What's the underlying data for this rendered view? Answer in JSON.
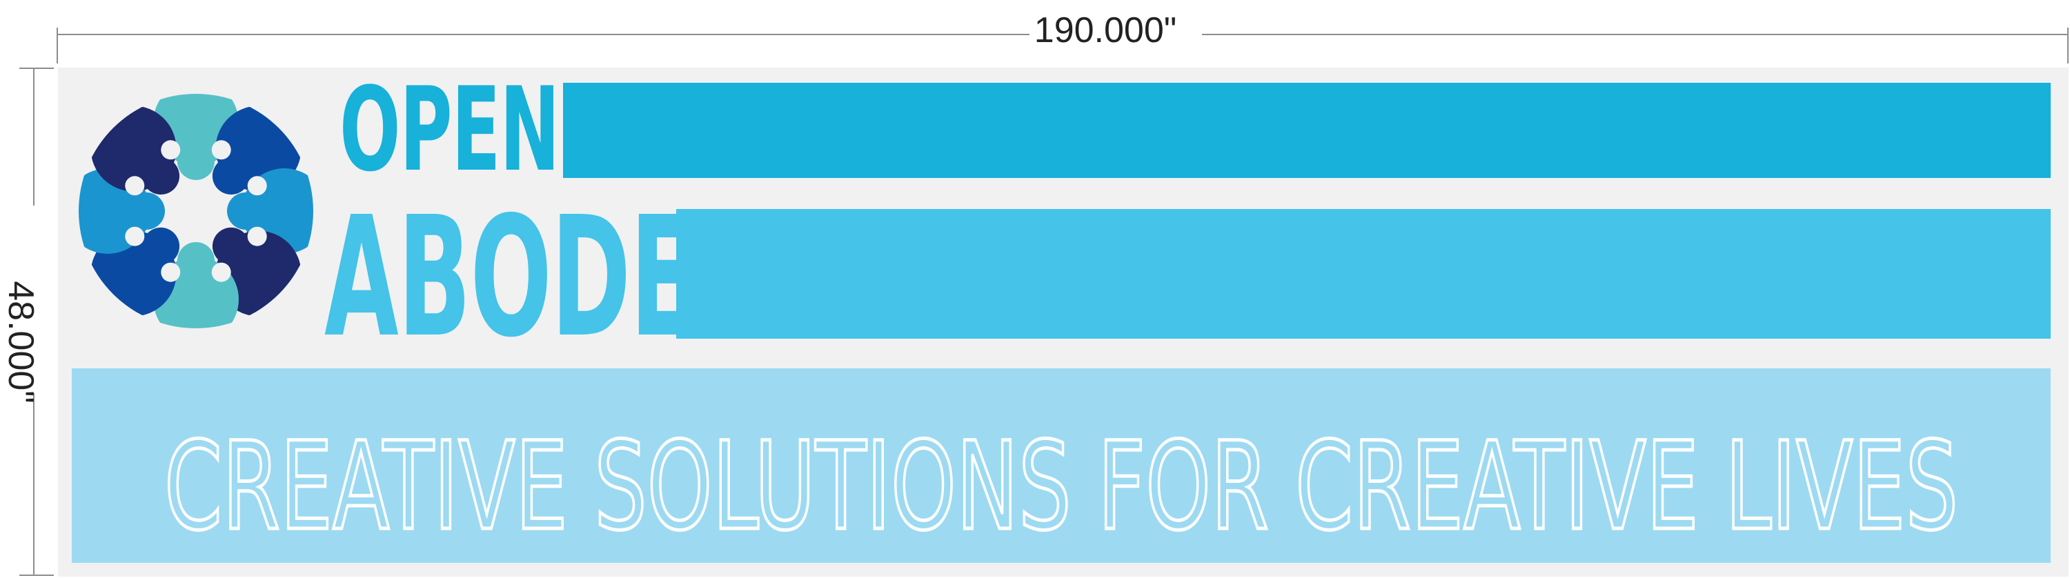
{
  "dimensions": {
    "width_label": "190.000\"",
    "height_label": "48.000\""
  },
  "brand": {
    "word1": "OPEN",
    "word2": "ABODE",
    "tagline": "CREATIVE SOLUTIONS FOR CREATIVE LIVES",
    "logo_icon": "people-circle-logo-icon"
  },
  "colors": {
    "panel_bg": "#f1f1f2",
    "open_text": "#17b1da",
    "abode_text": "#45c3e8",
    "bar_top": "#17b1da",
    "bar_bottom": "#45c3e8",
    "tagline_panel": "#9ddaf2",
    "tagline_outline": "#ffffff",
    "logo_navy": "#1f2a6c",
    "logo_blue": "#0b4aa2",
    "logo_cyan": "#1b95cf",
    "logo_teal": "#56c0c7",
    "dimension_line": "#8c8c8c"
  }
}
